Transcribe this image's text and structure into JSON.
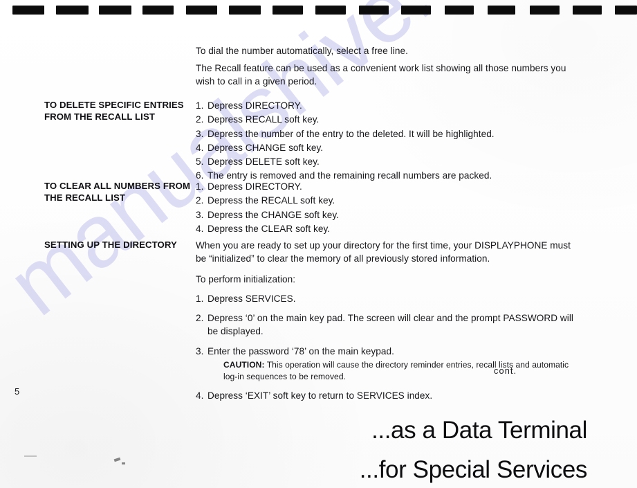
{
  "document": {
    "page_number": "5",
    "watermark": "manualshive.com",
    "continuation_note": "cont."
  },
  "intro": {
    "line1": "To dial the number automatically, select a free line.",
    "line2": "The Recall feature can be used as a convenient work list showing all those numbers you wish to call in a given period."
  },
  "sections": [
    {
      "heading": "TO DELETE SPECIFIC ENTRIES FROM THE RECALL LIST",
      "steps": [
        {
          "num": "1.",
          "text": "Depress DIRECTORY."
        },
        {
          "num": "2.",
          "text": "Depress RECALL soft key."
        },
        {
          "num": "3.",
          "text": "Depress the number of the entry to the deleted. It will be highlighted."
        },
        {
          "num": "4.",
          "text": "Depress CHANGE soft key."
        },
        {
          "num": "5.",
          "text": "Depress DELETE soft key."
        },
        {
          "num": "6.",
          "text": "The entry is removed and the remaining recall numbers are packed."
        }
      ]
    },
    {
      "heading": "TO CLEAR ALL NUMBERS FROM THE RECALL LIST",
      "steps": [
        {
          "num": "1.",
          "text": "Depress DIRECTORY."
        },
        {
          "num": "2.",
          "text": "Depress the RECALL soft key."
        },
        {
          "num": "3.",
          "text": "Depress the CHANGE soft key."
        },
        {
          "num": "4.",
          "text": "Depress the CLEAR soft key."
        }
      ]
    },
    {
      "heading": "SETTING UP THE DIRECTORY",
      "intro_para": "When you are ready to set up your directory for the first time, your DISPLAYPHONE must be “initialized” to clear the memory of all previously stored information.",
      "lead_in": "To perform initialization:",
      "steps": [
        {
          "num": "1.",
          "text": "Depress SERVICES."
        },
        {
          "num": "2.",
          "text": "Depress ‘0’ on the main key pad. The screen will clear and the prompt PASSWORD will be displayed."
        },
        {
          "num": "3.",
          "text": "Enter the password ‘78’ on the main keypad."
        }
      ],
      "caution": {
        "label": "CAUTION:",
        "text": " This operation will cause the directory reminder entries, recall lists and automatic log-in sequences to be removed."
      },
      "final_step": {
        "num": "4.",
        "text": "Depress ‘EXIT’ soft key to return to SERVICES index."
      }
    }
  ],
  "footer_headings": {
    "line1": "...as a Data Terminal",
    "line2": "...for Special Services"
  },
  "colors": {
    "ink": "#141414",
    "paper": "#ffffff",
    "watermark": "#c8c8ef",
    "dash": "#0c0c0c"
  }
}
